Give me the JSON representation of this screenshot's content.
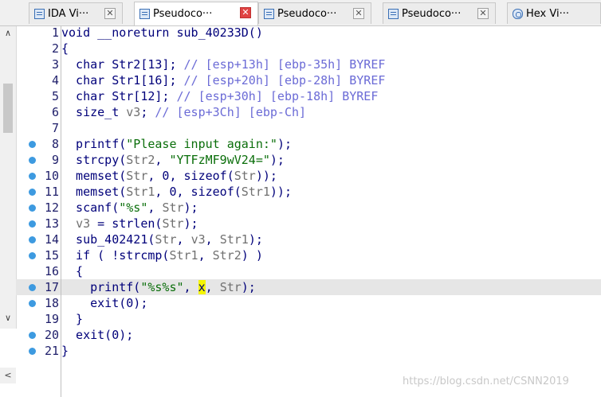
{
  "tabs": [
    {
      "label": "IDA Vi···",
      "icon": "ida-view-icon",
      "active": false,
      "close": "normal"
    },
    {
      "label": "Pseudoco···",
      "icon": "pseudocode-icon",
      "active": true,
      "close": "red"
    },
    {
      "label": "Pseudoco···",
      "icon": "pseudocode-icon",
      "active": false,
      "close": "normal"
    },
    {
      "label": "Pseudoco···",
      "icon": "pseudocode-icon",
      "active": false,
      "close": "normal"
    },
    {
      "label": "Hex Vi···",
      "icon": "hex-view-icon",
      "active": false,
      "close": "normal"
    }
  ],
  "close_glyph": "✕",
  "scroll": {
    "up": "∧",
    "down": "∨",
    "left": "<"
  },
  "code_lines": [
    {
      "n": "1",
      "bp": false,
      "hl": false,
      "tokens": [
        {
          "t": "void __noreturn sub_40233D()",
          "c": ""
        }
      ]
    },
    {
      "n": "2",
      "bp": false,
      "hl": false,
      "tokens": [
        {
          "t": "{",
          "c": ""
        }
      ]
    },
    {
      "n": "3",
      "bp": false,
      "hl": false,
      "tokens": [
        {
          "t": "  char Str2[13]; ",
          "c": ""
        },
        {
          "t": "// [esp+13h] [ebp-35h] BYREF",
          "c": "comment"
        }
      ]
    },
    {
      "n": "4",
      "bp": false,
      "hl": false,
      "tokens": [
        {
          "t": "  char Str1[16]; ",
          "c": ""
        },
        {
          "t": "// [esp+20h] [ebp-28h] BYREF",
          "c": "comment"
        }
      ]
    },
    {
      "n": "5",
      "bp": false,
      "hl": false,
      "tokens": [
        {
          "t": "  char Str[12]; ",
          "c": ""
        },
        {
          "t": "// [esp+30h] [ebp-18h] BYREF",
          "c": "comment"
        }
      ]
    },
    {
      "n": "6",
      "bp": false,
      "hl": false,
      "tokens": [
        {
          "t": "  size_t ",
          "c": ""
        },
        {
          "t": "v3",
          "c": "var"
        },
        {
          "t": "; ",
          "c": ""
        },
        {
          "t": "// [esp+3Ch] [ebp-Ch]",
          "c": "comment"
        }
      ]
    },
    {
      "n": "7",
      "bp": false,
      "hl": false,
      "tokens": [
        {
          "t": "",
          "c": ""
        }
      ]
    },
    {
      "n": "8",
      "bp": true,
      "hl": false,
      "tokens": [
        {
          "t": "  printf(",
          "c": ""
        },
        {
          "t": "\"Please input again:\"",
          "c": "str"
        },
        {
          "t": ");",
          "c": ""
        }
      ]
    },
    {
      "n": "9",
      "bp": true,
      "hl": false,
      "tokens": [
        {
          "t": "  strcpy(",
          "c": ""
        },
        {
          "t": "Str2",
          "c": "var"
        },
        {
          "t": ", ",
          "c": ""
        },
        {
          "t": "\"YTFzMF9wV24=\"",
          "c": "str"
        },
        {
          "t": ");",
          "c": ""
        }
      ]
    },
    {
      "n": "10",
      "bp": true,
      "hl": false,
      "tokens": [
        {
          "t": "  memset(",
          "c": ""
        },
        {
          "t": "Str",
          "c": "var"
        },
        {
          "t": ", 0, sizeof(",
          "c": ""
        },
        {
          "t": "Str",
          "c": "var"
        },
        {
          "t": "));",
          "c": ""
        }
      ]
    },
    {
      "n": "11",
      "bp": true,
      "hl": false,
      "tokens": [
        {
          "t": "  memset(",
          "c": ""
        },
        {
          "t": "Str1",
          "c": "var"
        },
        {
          "t": ", 0, sizeof(",
          "c": ""
        },
        {
          "t": "Str1",
          "c": "var"
        },
        {
          "t": "));",
          "c": ""
        }
      ]
    },
    {
      "n": "12",
      "bp": true,
      "hl": false,
      "tokens": [
        {
          "t": "  scanf(",
          "c": ""
        },
        {
          "t": "\"%s\"",
          "c": "str"
        },
        {
          "t": ", ",
          "c": ""
        },
        {
          "t": "Str",
          "c": "var"
        },
        {
          "t": ");",
          "c": ""
        }
      ]
    },
    {
      "n": "13",
      "bp": true,
      "hl": false,
      "tokens": [
        {
          "t": "  ",
          "c": ""
        },
        {
          "t": "v3",
          "c": "var"
        },
        {
          "t": " = strlen(",
          "c": ""
        },
        {
          "t": "Str",
          "c": "var"
        },
        {
          "t": ");",
          "c": ""
        }
      ]
    },
    {
      "n": "14",
      "bp": true,
      "hl": false,
      "tokens": [
        {
          "t": "  sub_402421(",
          "c": ""
        },
        {
          "t": "Str",
          "c": "var"
        },
        {
          "t": ", ",
          "c": ""
        },
        {
          "t": "v3",
          "c": "var"
        },
        {
          "t": ", ",
          "c": ""
        },
        {
          "t": "Str1",
          "c": "var"
        },
        {
          "t": ");",
          "c": ""
        }
      ]
    },
    {
      "n": "15",
      "bp": true,
      "hl": false,
      "tokens": [
        {
          "t": "  if ( !strcmp(",
          "c": ""
        },
        {
          "t": "Str1",
          "c": "var"
        },
        {
          "t": ", ",
          "c": ""
        },
        {
          "t": "Str2",
          "c": "var"
        },
        {
          "t": ") )",
          "c": ""
        }
      ]
    },
    {
      "n": "16",
      "bp": false,
      "hl": false,
      "tokens": [
        {
          "t": "  {",
          "c": ""
        }
      ]
    },
    {
      "n": "17",
      "bp": true,
      "hl": true,
      "tokens": [
        {
          "t": "    printf(",
          "c": ""
        },
        {
          "t": "\"%s%s\"",
          "c": "str"
        },
        {
          "t": ", ",
          "c": ""
        },
        {
          "t": "x",
          "c": "cursor"
        },
        {
          "t": ", ",
          "c": ""
        },
        {
          "t": "Str",
          "c": "var"
        },
        {
          "t": ");",
          "c": ""
        }
      ]
    },
    {
      "n": "18",
      "bp": true,
      "hl": false,
      "tokens": [
        {
          "t": "    exit(0);",
          "c": ""
        }
      ]
    },
    {
      "n": "19",
      "bp": false,
      "hl": false,
      "tokens": [
        {
          "t": "  }",
          "c": ""
        }
      ]
    },
    {
      "n": "20",
      "bp": true,
      "hl": false,
      "tokens": [
        {
          "t": "  exit(0);",
          "c": ""
        }
      ]
    },
    {
      "n": "21",
      "bp": true,
      "hl": false,
      "tokens": [
        {
          "t": "}",
          "c": ""
        }
      ]
    }
  ],
  "colors": {
    "code_text": "#00007a",
    "comment": "#6b6bd6",
    "string": "#0a6e0a",
    "variable": "#707070",
    "breakpoint": "#3d9ae0",
    "highlight_row": "#e6e6e6",
    "cursor": "#f5f500",
    "close_active": "#e04343"
  },
  "watermark": "https://blog.csdn.net/CSNN2019"
}
